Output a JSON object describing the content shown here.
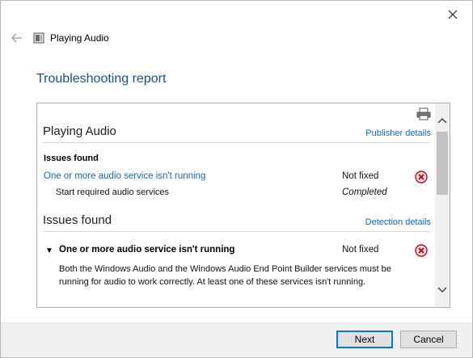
{
  "window": {
    "close_icon": "close-icon",
    "back_icon": "back-arrow-icon",
    "app_icon": "troubleshooter-icon",
    "app_title": "Playing Audio"
  },
  "page": {
    "title": "Troubleshooting report"
  },
  "report": {
    "printer_icon": "printer-icon",
    "section1": {
      "title": "Playing Audio",
      "link": "Publisher details",
      "issues_label": "Issues found",
      "issue_link": "One or more audio service isn't running",
      "issue_status": "Not fixed",
      "step_text": "Start required audio services",
      "step_status": "Completed"
    },
    "section2": {
      "title": "Issues found",
      "link": "Detection details",
      "issue_title": "One or more audio service isn't running",
      "issue_status": "Not fixed",
      "description": "Both the Windows Audio and the Windows Audio End Point Builder services must be running for audio to work correctly. At least one of these services isn't running."
    },
    "colors": {
      "accent": "#1166c4",
      "title": "#1a4f8e",
      "error": "#d0021b"
    }
  },
  "footer": {
    "next_label": "Next",
    "cancel_label": "Cancel"
  }
}
